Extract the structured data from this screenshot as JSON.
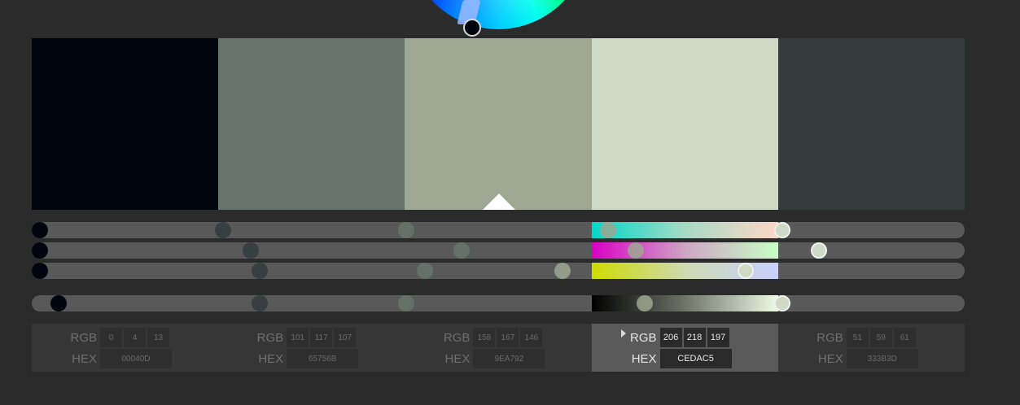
{
  "swatches": [
    {
      "hex": "#00040D",
      "rgb": [
        "0",
        "4",
        "13"
      ],
      "hex_label": "00040D",
      "active": false
    },
    {
      "hex": "#65756B",
      "rgb": [
        "101",
        "117",
        "107"
      ],
      "hex_label": "65756B",
      "active": false
    },
    {
      "hex": "#9EA792",
      "rgb": [
        "158",
        "167",
        "146"
      ],
      "hex_label": "9EA792",
      "active": true
    },
    {
      "hex": "#CEDAC5",
      "rgb": [
        "206",
        "218",
        "197"
      ],
      "hex_label": "CEDAC5",
      "active": false
    },
    {
      "hex": "#333B3D",
      "rgb": [
        "51",
        "59",
        "61"
      ],
      "hex_label": "333B3D",
      "active": false
    }
  ],
  "labels": {
    "rgb": "RGB",
    "hex": "HEX"
  },
  "sliders": {
    "rows": [
      "red",
      "green",
      "blue",
      "brightness"
    ],
    "values": [
      [
        0,
        0,
        0,
        0.02
      ],
      [
        0.4,
        0.46,
        0.42,
        0.4
      ],
      [
        0.62,
        0.65,
        0.57,
        0.66
      ],
      [
        0.81,
        0.85,
        0.77,
        0.81
      ],
      [
        0.2,
        0.23,
        0.24,
        0.24
      ]
    ]
  },
  "colors": {
    "background": "#2b2b2b",
    "track": "#595959",
    "panel": "#363636",
    "panel_active": "#5a5a5a",
    "gradients": [
      "linear-gradient(to right, #00d8c8, #a7dac5, #ffd6c5)",
      "linear-gradient(to right, #d800c5, #cea6c5, #c8ffc5)",
      "linear-gradient(to right, #cedc00, #cedab0, #c8d0ff)",
      "linear-gradient(to right, #000000, #6e7468, #eefce6)"
    ]
  }
}
